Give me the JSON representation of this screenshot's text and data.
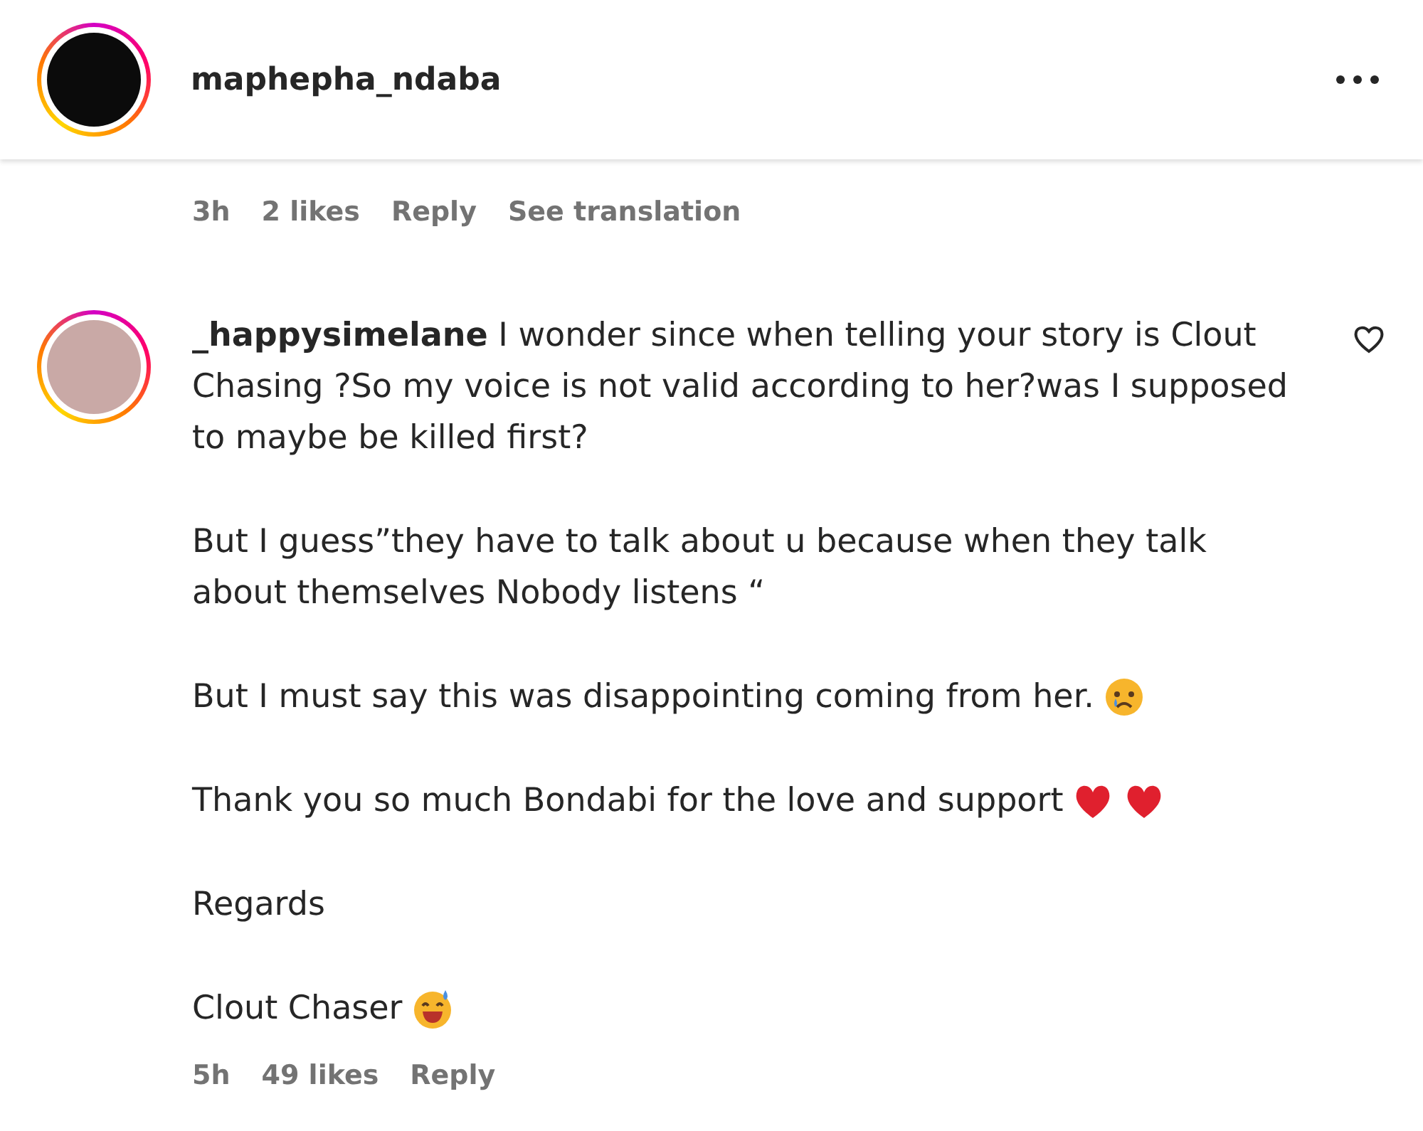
{
  "post_header": {
    "username": "maphepha_ndaba"
  },
  "previous_comment_meta": {
    "time": "3h",
    "likes": "2 likes",
    "reply": "Reply",
    "translate": "See translation"
  },
  "comment": {
    "liked": false,
    "paragraphs": [
      {
        "text": "**_happysimelane** I wonder since when telling your story is Clout Chasing ?So my voice is not valid according to her?was I supposed to maybe be killed first?"
      },
      {
        "text": "But I guess”they have to talk about u because when they talk about themselves Nobody listens “"
      },
      {
        "text": "But I must say this was disappointing coming from her.",
        "emojis": [
          {
            "kind": "tear"
          }
        ]
      },
      {
        "text": "Thank you so much Bondabi for the love and support",
        "emojis": [
          {
            "kind": "heart"
          },
          {
            "kind": "heart"
          }
        ]
      },
      {
        "text": "Regards"
      },
      {
        "text": "Clout Chaser",
        "emojis": [
          {
            "kind": "sweat-grin"
          }
        ]
      }
    ],
    "meta": {
      "time": "5h",
      "likes": "49 likes",
      "reply": "Reply"
    }
  }
}
